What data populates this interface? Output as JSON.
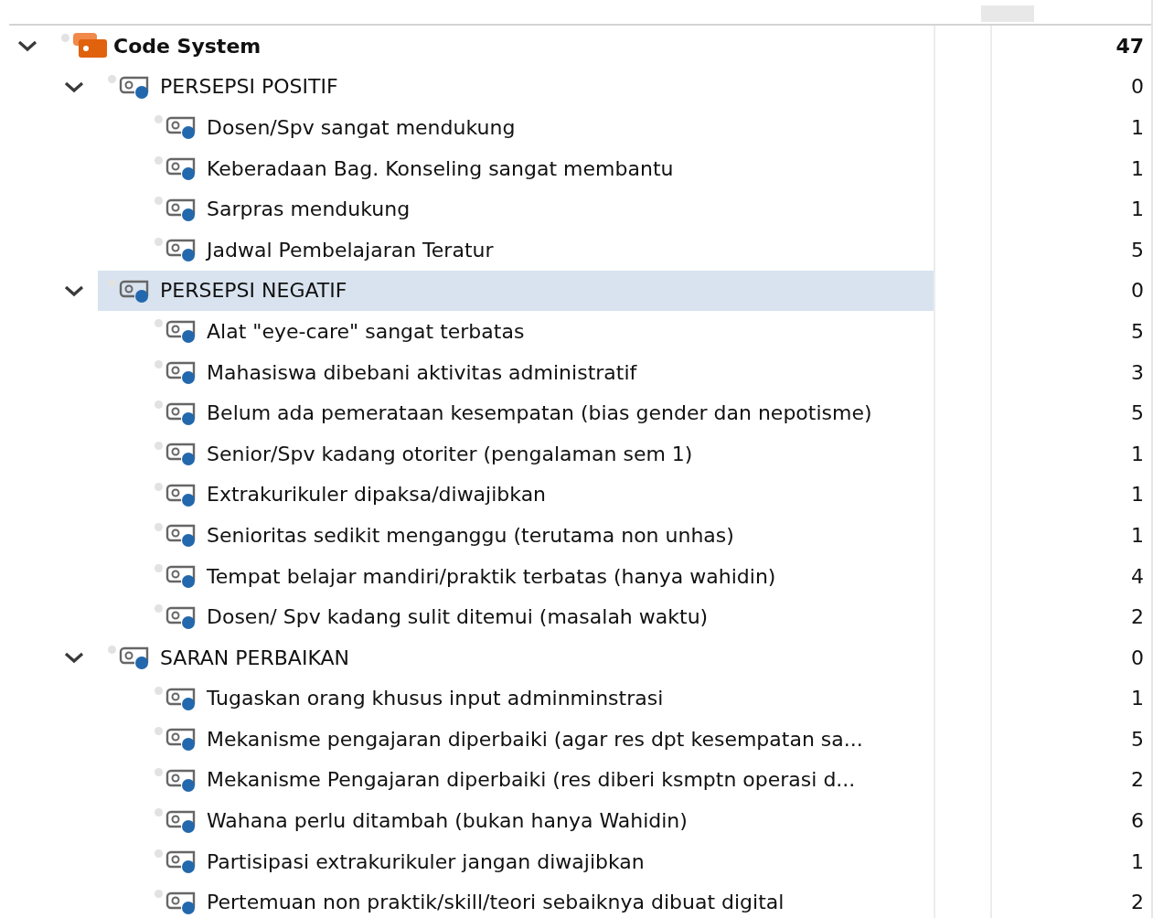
{
  "code_system": {
    "label": "Code System",
    "count": "47",
    "expanded": true,
    "selected": false,
    "children": [
      {
        "label": "PERSEPSI POSITIF",
        "count": "0",
        "expanded": true,
        "selected": false,
        "children": [
          {
            "label": "Dosen/Spv sangat mendukung",
            "count": "1",
            "selected": false
          },
          {
            "label": "Keberadaan Bag. Konseling sangat membantu",
            "count": "1",
            "selected": false
          },
          {
            "label": "Sarpras mendukung",
            "count": "1",
            "selected": false
          },
          {
            "label": "Jadwal Pembelajaran Teratur",
            "count": "5",
            "selected": false
          }
        ]
      },
      {
        "label": "PERSEPSI NEGATIF",
        "count": "0",
        "expanded": true,
        "selected": true,
        "children": [
          {
            "label": "Alat \"eye-care\" sangat terbatas",
            "count": "5",
            "selected": false
          },
          {
            "label": "Mahasiswa dibebani aktivitas administratif",
            "count": "3",
            "selected": false
          },
          {
            "label": "Belum ada pemerataan kesempatan (bias gender dan nepotisme)",
            "count": "5",
            "selected": false
          },
          {
            "label": "Senior/Spv kadang otoriter (pengalaman sem 1)",
            "count": "1",
            "selected": false
          },
          {
            "label": "Extrakurikuler dipaksa/diwajibkan",
            "count": "1",
            "selected": false
          },
          {
            "label": "Senioritas sedikit menganggu (terutama non unhas)",
            "count": "1",
            "selected": false
          },
          {
            "label": "Tempat belajar mandiri/praktik terbatas (hanya wahidin)",
            "count": "4",
            "selected": false
          },
          {
            "label": "Dosen/ Spv kadang sulit ditemui (masalah waktu)",
            "count": "2",
            "selected": false
          }
        ]
      },
      {
        "label": "SARAN PERBAIKAN",
        "count": "0",
        "expanded": true,
        "selected": false,
        "children": [
          {
            "label": "Tugaskan orang khusus input adminminstrasi",
            "count": "1",
            "selected": false
          },
          {
            "label": "Mekanisme pengajaran diperbaiki (agar res dpt kesempatan sa...",
            "count": "5",
            "selected": false
          },
          {
            "label": "Mekanisme Pengajaran diperbaiki (res diberi ksmptn operasi d...",
            "count": "2",
            "selected": false
          },
          {
            "label": "Wahana perlu ditambah (bukan hanya Wahidin)",
            "count": "6",
            "selected": false
          },
          {
            "label": "Partisipasi extrakurikuler jangan diwajibkan",
            "count": "1",
            "selected": false
          },
          {
            "label": "Pertemuan non praktik/skill/teori sebaiknya dibuat digital",
            "count": "2",
            "selected": false
          }
        ]
      }
    ]
  }
}
